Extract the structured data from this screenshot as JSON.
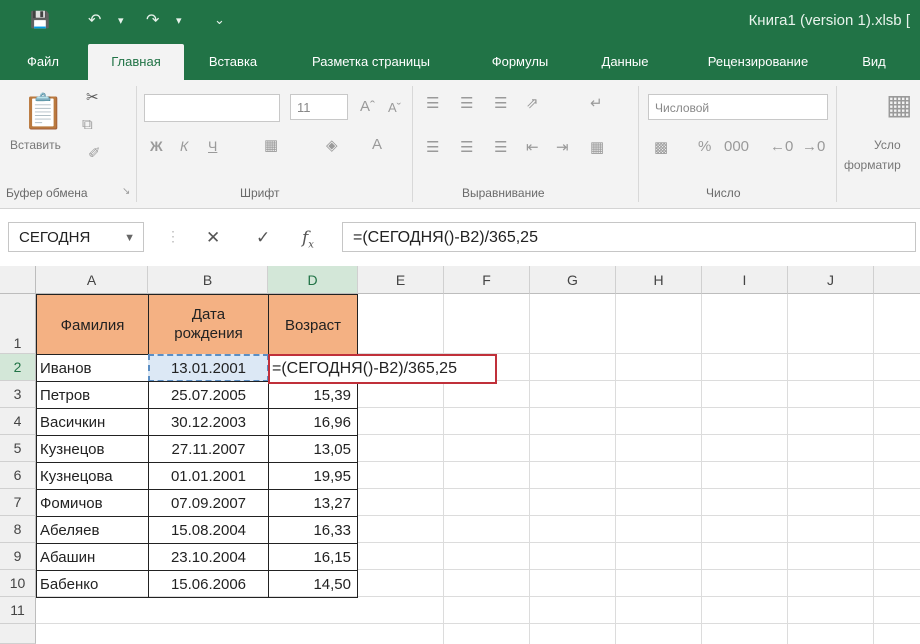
{
  "app": {
    "title": "Книга1 (version 1).xlsb [",
    "quick_access": [
      "save-icon",
      "undo-icon",
      "redo-icon",
      "customize-icon"
    ]
  },
  "ribbon_tabs": [
    "Файл",
    "Главная",
    "Вставка",
    "Разметка страницы",
    "Формулы",
    "Данные",
    "Рецензирование",
    "Вид"
  ],
  "active_tab": "Главная",
  "ribbon": {
    "clipboard": {
      "paste_label": "Вставить",
      "group_label": "Буфер обмена"
    },
    "font": {
      "size": "11",
      "bold": "Ж",
      "italic": "К",
      "underline": "Ч",
      "group_label": "Шрифт"
    },
    "alignment": {
      "group_label": "Выравнивание"
    },
    "number": {
      "format": "Числовой",
      "group_label": "Число"
    },
    "styles": {
      "conditional_label": "Усло",
      "format_label": "форматир"
    }
  },
  "formula_bar": {
    "name_box": "СЕГОДНЯ",
    "formula": "=(СЕГОДНЯ()-B2)/365,25"
  },
  "sheet": {
    "columns": [
      "A",
      "B",
      "D",
      "E",
      "F",
      "G",
      "H",
      "I",
      "J"
    ],
    "rows": [
      "1",
      "2",
      "3",
      "4",
      "5",
      "6",
      "7",
      "8",
      "9",
      "10",
      "11"
    ],
    "headers": {
      "surname": "Фамилия",
      "birth_date": "Дата\nрождения",
      "age": "Возраст"
    },
    "data": [
      {
        "surname": "Иванов",
        "birth": "13.01.2001",
        "age": ""
      },
      {
        "surname": "Петров",
        "birth": "25.07.2005",
        "age": "15,39"
      },
      {
        "surname": "Васичкин",
        "birth": "30.12.2003",
        "age": "16,96"
      },
      {
        "surname": "Кузнецов",
        "birth": "27.11.2007",
        "age": "13,05"
      },
      {
        "surname": "Кузнецова",
        "birth": "01.01.2001",
        "age": "19,95"
      },
      {
        "surname": "Фомичов",
        "birth": "07.09.2007",
        "age": "13,27"
      },
      {
        "surname": "Абеляев",
        "birth": "15.08.2004",
        "age": "16,33"
      },
      {
        "surname": "Абашин",
        "birth": "23.10.2004",
        "age": "16,15"
      },
      {
        "surname": "Бабенко",
        "birth": "15.06.2006",
        "age": "14,50"
      }
    ],
    "edit_cell_formula": "=(СЕГОДНЯ()-B2)/365,25",
    "selected_column": "D",
    "selected_row": "2",
    "colors": {
      "header_fill": "#f4b183",
      "accent": "#217346",
      "edit_border": "#c0303a"
    }
  }
}
